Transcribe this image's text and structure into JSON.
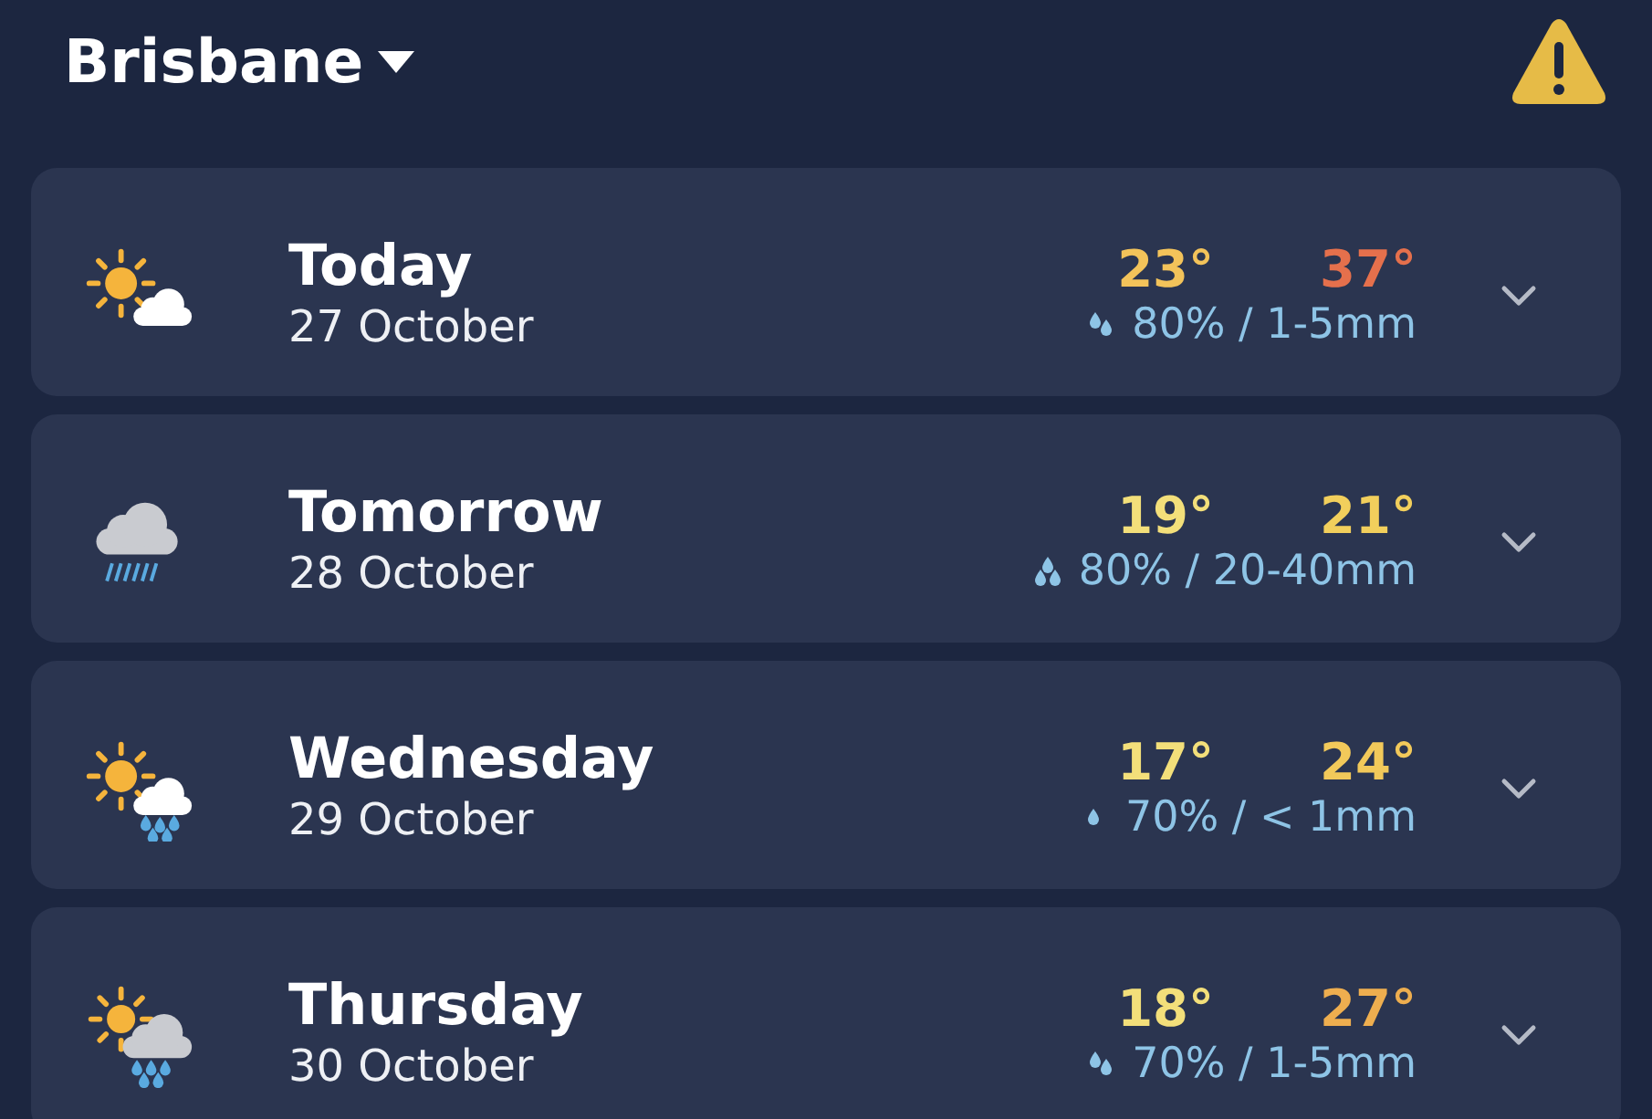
{
  "header": {
    "location": "Brisbane"
  },
  "days": [
    {
      "kind": "sun-cloud",
      "day": "Today",
      "date": "27 October",
      "temps": [
        {
          "text": "23°",
          "color": "#f3c35a"
        },
        {
          "text": "37°",
          "color": "#e5704c"
        }
      ],
      "rain": {
        "kind": "two-drops",
        "text": "80% / 1-5mm"
      },
      "expanded": false
    },
    {
      "kind": "rain-cloud",
      "day": "Tomorrow",
      "date": "28 October",
      "temps": [
        {
          "text": "19°",
          "color": "#f3df7a"
        },
        {
          "text": "21°",
          "color": "#f2cf5c"
        }
      ],
      "rain": {
        "kind": "three-drops",
        "text": "80% / 20-40mm"
      },
      "expanded": false
    },
    {
      "kind": "sun-cloud-showers",
      "day": "Wednesday",
      "date": "29 October",
      "temps": [
        {
          "text": "17°",
          "color": "#f3df7a"
        },
        {
          "text": "24°",
          "color": "#f2c95a"
        }
      ],
      "rain": {
        "kind": "one-drop",
        "text": "70% / < 1mm"
      },
      "expanded": false
    },
    {
      "kind": "sun-grey-cloud-showers",
      "day": "Thursday",
      "date": "30 October",
      "temps": [
        {
          "text": "18°",
          "color": "#f3df7a"
        },
        {
          "text": "27°",
          "color": "#eeae4f"
        }
      ],
      "rain": {
        "kind": "two-drops",
        "text": "70% / 1-5mm"
      },
      "expanded": false
    }
  ]
}
